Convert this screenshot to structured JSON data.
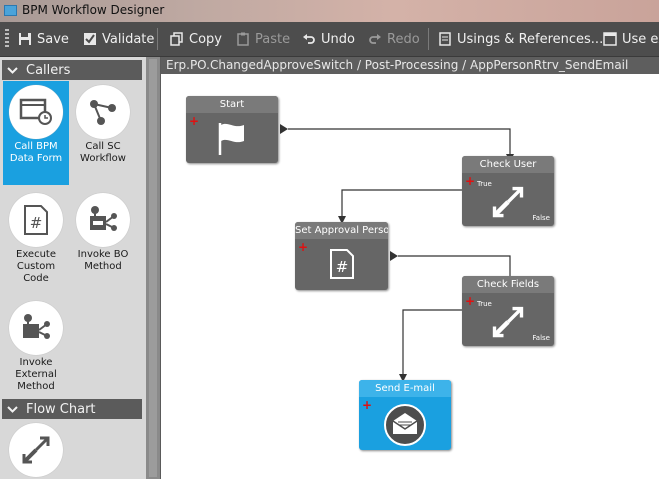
{
  "window": {
    "title": "BPM Workflow Designer"
  },
  "toolbar": {
    "save": "Save",
    "validate": "Validate",
    "copy": "Copy",
    "paste": "Paste",
    "undo": "Undo",
    "redo": "Redo",
    "usings": "Usings & References...",
    "use_ext": "Use ex"
  },
  "sidebar": {
    "callers_header": "Callers",
    "flowchart_header": "Flow Chart",
    "tools": [
      {
        "label": "Call BPM Data Form",
        "icon": "data-form-icon",
        "selected": true
      },
      {
        "label": "Call SC Workflow",
        "icon": "workflow-icon",
        "selected": false
      },
      {
        "label": "Execute Custom Code",
        "icon": "code-file-icon",
        "selected": false
      },
      {
        "label": "Invoke BO Method",
        "icon": "bo-method-icon",
        "selected": false
      },
      {
        "label": "Invoke External Method",
        "icon": "external-method-icon",
        "selected": false
      }
    ]
  },
  "breadcrumb": "Erp.PO.ChangedApproveSwitch / Post-Processing / AppPersonRtrv_SendEmail",
  "nodes": {
    "start": {
      "title": "Start"
    },
    "check_user": {
      "title": "Check User",
      "true_label": "True",
      "false_label": "False"
    },
    "set_approval": {
      "title": "Set Approval Perso"
    },
    "check_fields": {
      "title": "Check Fields",
      "true_label": "True",
      "false_label": "False"
    },
    "send_email": {
      "title": "Send E-mail"
    }
  },
  "colors": {
    "accent": "#1aa0e0",
    "toolbar": "#4d4d4d",
    "node": "#666666"
  }
}
